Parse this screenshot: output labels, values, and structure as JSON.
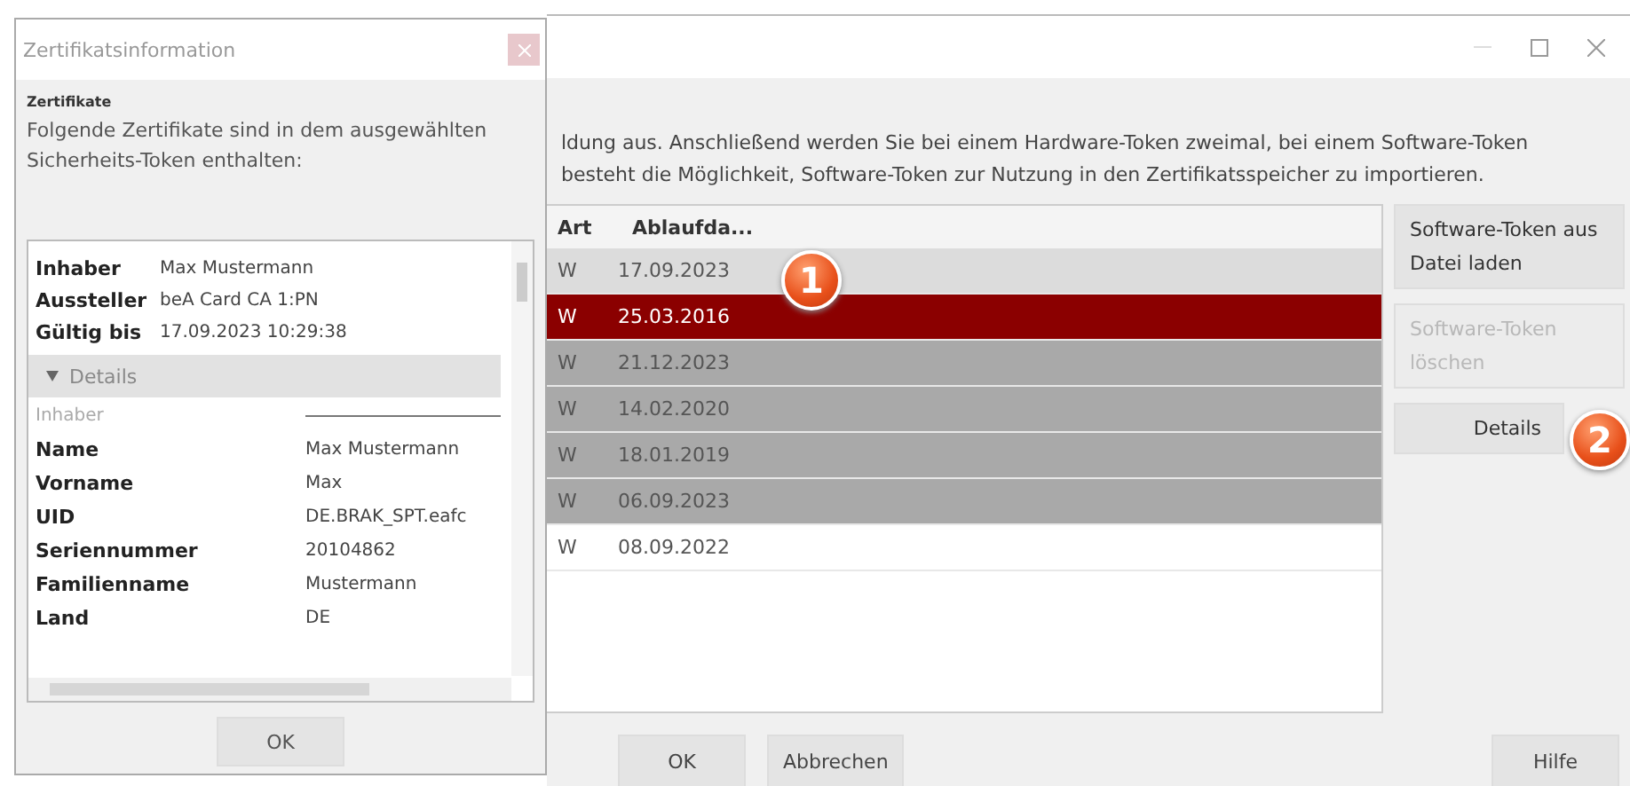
{
  "back_window": {
    "intro_lines": [
      "ldung aus. Anschließend werden Sie bei einem Hardware-Token zweimal, bei einem Software-Token",
      "besteht die Möglichkeit, Software-Token zur Nutzung in den Zertifikatsspeicher zu importieren."
    ],
    "table": {
      "columns": [
        "Art",
        "Ablaufda..."
      ],
      "rows": [
        {
          "art": "W",
          "expiry": "17.09.2023",
          "selected": false,
          "color": "#dcdcdc"
        },
        {
          "art": "W",
          "expiry": "25.03.2016",
          "selected": true
        },
        {
          "art": "W",
          "expiry": "21.12.2023",
          "selected": false,
          "color": "#a9a9a9"
        },
        {
          "art": "W",
          "expiry": "14.02.2020",
          "selected": false,
          "color": "#a9a9a9"
        },
        {
          "art": "W",
          "expiry": "18.01.2019",
          "selected": false,
          "color": "#a9a9a9"
        },
        {
          "art": "W",
          "expiry": "06.09.2023",
          "selected": false,
          "color": "#a9a9a9"
        },
        {
          "art": "W",
          "expiry": "08.09.2022",
          "selected": false,
          "color": "#ffffff"
        }
      ]
    },
    "side_buttons": [
      {
        "label": "Software-Token aus Datei laden",
        "disabled": false
      },
      {
        "label": "Software-Token löschen",
        "disabled": true
      },
      {
        "label": "Details",
        "disabled": false
      }
    ],
    "footer_buttons": [
      "OK",
      "Abbrechen"
    ],
    "help_button": "Hilfe"
  },
  "callouts": [
    "1",
    "2"
  ],
  "dialog": {
    "title": "Zertifikatsinformation",
    "heading": "Zertifikate",
    "description": "Folgende Zertifikate sind in dem ausgewählten Sicherheits-Token enthalten:",
    "summary": [
      {
        "label": "Inhaber",
        "value": "Max Mustermann"
      },
      {
        "label": "Aussteller",
        "value": "beA Card CA 1:PN"
      },
      {
        "label": "Gültig bis",
        "value": "17.09.2023 10:29:38"
      }
    ],
    "details": {
      "label": "Details",
      "expanded": true,
      "section": "Inhaber",
      "fields": [
        {
          "label": "Name",
          "value": "Max Mustermann"
        },
        {
          "label": "Vorname",
          "value": "Max"
        },
        {
          "label": "UID",
          "value": "DE.BRAK_SPT.eafc"
        },
        {
          "label": "Seriennummer",
          "value": "20104862"
        },
        {
          "label": "Familienname",
          "value": "Mustermann"
        },
        {
          "label": "Land",
          "value": "DE"
        }
      ]
    },
    "ok_button": "OK"
  }
}
